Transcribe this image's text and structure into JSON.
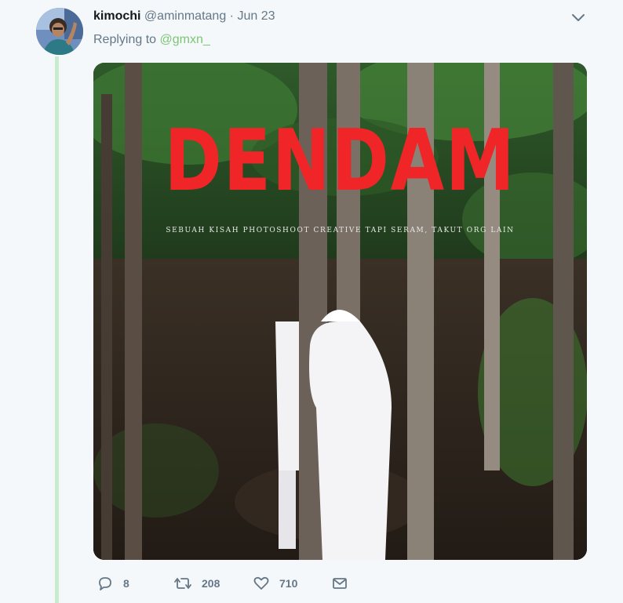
{
  "tweet": {
    "display_name": "kimochi",
    "handle": "@aminmatang",
    "separator": "·",
    "date": "Jun 23",
    "replying_prefix": "Replying to",
    "replying_to": "@gmxn_"
  },
  "media": {
    "title": "DENDAM",
    "subtitle": "SEBUAH KISAH PHOTOSHOOT CREATIVE TAPI SERAM, TAKUT ORG LAIN"
  },
  "actions": {
    "reply_count": "8",
    "retweet_count": "208",
    "like_count": "710"
  },
  "icons": {
    "header": "chevron-down-icon",
    "reply": "reply-icon",
    "retweet": "retweet-icon",
    "like": "heart-icon",
    "message": "envelope-icon"
  },
  "colors": {
    "background": "#f4f8fb",
    "thread_line": "#c9ecd0",
    "mention": "#7cc674",
    "muted": "#657786",
    "title_red": "#ef2528"
  }
}
